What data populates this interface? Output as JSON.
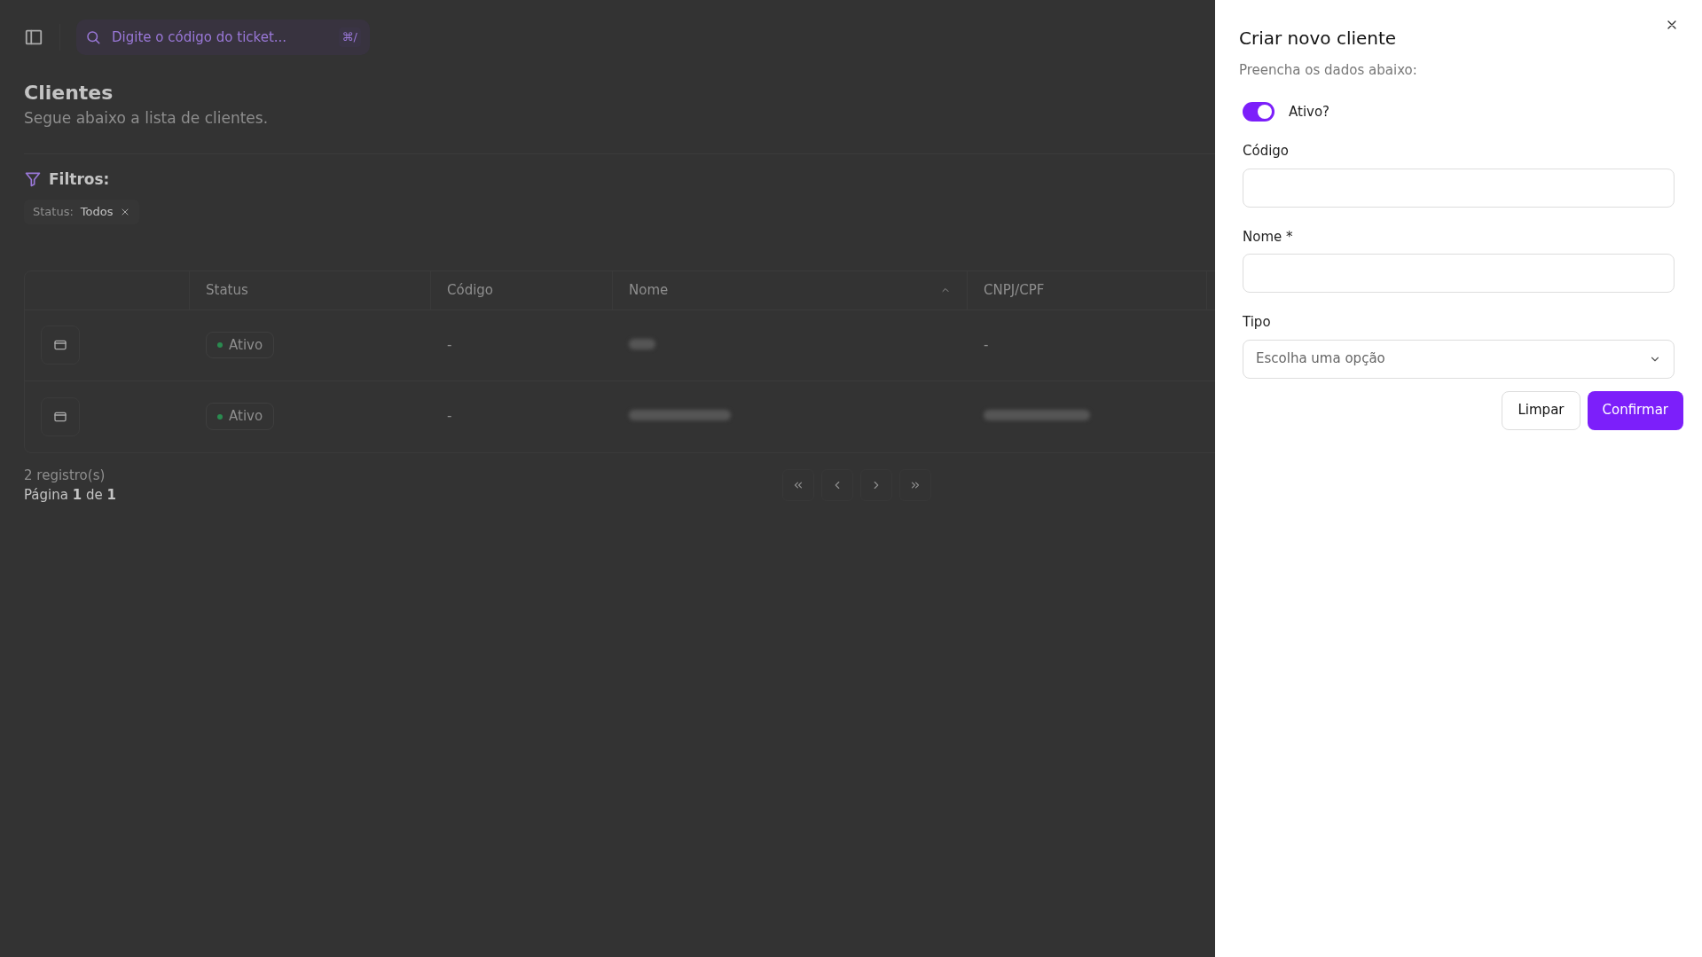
{
  "topbar": {
    "search": {
      "placeholder": "Digite o código do ticket...",
      "shortcut": "⌘/"
    }
  },
  "page": {
    "title": "Clientes",
    "subtitle": "Segue abaixo a lista de clientes."
  },
  "filters": {
    "label": "Filtros:",
    "chips": [
      {
        "name": "Status:",
        "value": "Todos"
      }
    ]
  },
  "table": {
    "columns": [
      {
        "sorted": false
      },
      {
        "label": "Status",
        "sorted": false
      },
      {
        "label": "Código",
        "sorted": false
      },
      {
        "label": "Nome",
        "sorted": true
      },
      {
        "label": "CNPJ/CPF",
        "sorted": false
      }
    ],
    "rows": [
      {
        "status": "Ativo",
        "codigo": "-",
        "nome": {
          "redacted": true
        },
        "documento": {
          "text": "-",
          "redacted": false
        }
      },
      {
        "status": "Ativo",
        "codigo": "-",
        "nome": {
          "redacted": true
        },
        "documento": {
          "redacted": true
        }
      }
    ]
  },
  "footer": {
    "count": "2 registro(s)",
    "page": "Página **1** de **1**",
    "pager": [
      {
        "kind": "first"
      },
      {
        "kind": "prev"
      },
      {
        "kind": "next"
      },
      {
        "kind": "last"
      }
    ]
  },
  "drawer": {
    "title": "Criar novo cliente",
    "subtitle": "Preencha os dados abaixo:",
    "switch": {
      "label": "Ativo?",
      "on": true
    },
    "fields": [
      {
        "kind": "text",
        "label": "Código"
      },
      {
        "kind": "text",
        "label": "Nome *"
      },
      {
        "kind": "select",
        "label": "Tipo",
        "placeholder": "Escolha uma opção"
      }
    ],
    "buttons": [
      {
        "kind": "secondary",
        "label": "Limpar"
      },
      {
        "kind": "primary",
        "label": "Confirmar"
      }
    ]
  }
}
